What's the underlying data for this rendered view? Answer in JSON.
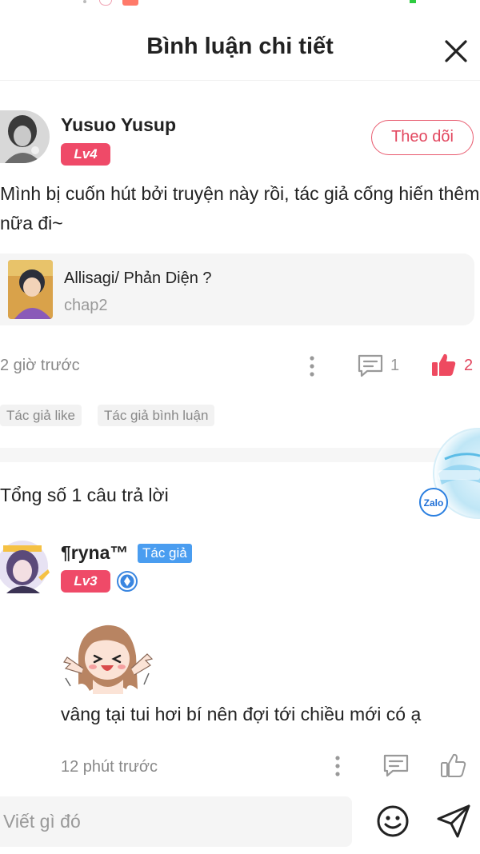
{
  "header": {
    "title": "Bình luận chi tiết",
    "close_icon": "close-icon"
  },
  "comment": {
    "username": "Yusuo Yusup",
    "level": "Lv4",
    "follow_label": "Theo dõi",
    "text": "Mình bị cuốn hút bởi truyện này rồi, tác giả cống hiến thêm nữa đi~",
    "story": {
      "title": "Allisagi/ Phản Diện ?",
      "chapter": "chap2"
    },
    "time": "2 giờ trước",
    "reply_count": "1",
    "like_count": "2",
    "tags": [
      "Tác giả like",
      "Tác giả bình luận"
    ]
  },
  "floating_widget": {
    "label": "Zalo"
  },
  "replies": {
    "total_label": "Tổng số 1 câu trả lời",
    "items": [
      {
        "username": "¶ryna™",
        "author_badge": "Tác giả",
        "level": "Lv3",
        "text": "vâng tại tui hơi bí nên đợi tới chiều mới có ạ",
        "time": "12 phút trước"
      }
    ]
  },
  "composer": {
    "placeholder": "Viết gì đó"
  },
  "colors": {
    "accent": "#e2465e",
    "level_badge": "#ef4a68",
    "author_badge": "#4a9df0"
  }
}
